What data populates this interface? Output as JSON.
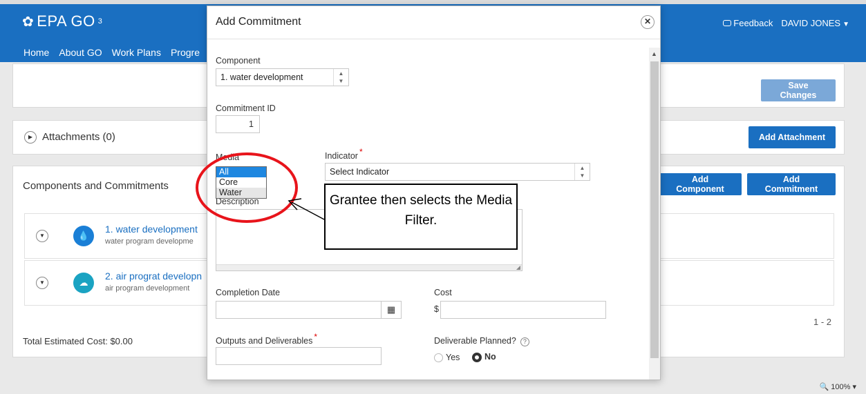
{
  "header": {
    "brand": "EPA GO",
    "brand_sup": "3",
    "nav": [
      "Home",
      "About GO",
      "Work Plans",
      "Progre"
    ],
    "feedback": "Feedback",
    "user": "DAVID JONES"
  },
  "background": {
    "save_changes": "Save Changes",
    "attachments_label": "Attachments (0)",
    "add_attachment": "Add Attachment",
    "components_label": "Components and Commitments",
    "add_component": "Add Component",
    "add_commitment": "Add Commitment",
    "rows": [
      {
        "title": "1. water development",
        "subtitle": "water program developme",
        "icon": "water-drop-icon",
        "color": "#1a7fd6"
      },
      {
        "title": "2. air prograt developn",
        "subtitle": "air program development",
        "icon": "cloud-icon",
        "color": "#1aa3c2"
      }
    ],
    "pager": "1 - 2",
    "total_cost": "Total Estimated Cost: $0.00",
    "zoom": "100%"
  },
  "modal": {
    "title": "Add Commitment",
    "component_label": "Component",
    "component_value": "1. water development",
    "commitment_id_label": "Commitment ID",
    "commitment_id_value": "1",
    "media_label": "Media",
    "media_options": [
      "All",
      "Core",
      "Water"
    ],
    "media_selected": "All",
    "indicator_label": "Indicator",
    "indicator_value": "Select Indicator",
    "description_label": "Description",
    "completion_date_label": "Completion Date",
    "cost_label": "Cost",
    "cost_prefix": "$",
    "outputs_label": "Outputs and Deliverables",
    "deliverable_label": "Deliverable Planned?",
    "yes_label": "Yes",
    "no_label": "No"
  },
  "annotation": {
    "callout_text": "Grantee then selects the Media Filter.",
    "highlight_color": "#e8141b"
  }
}
